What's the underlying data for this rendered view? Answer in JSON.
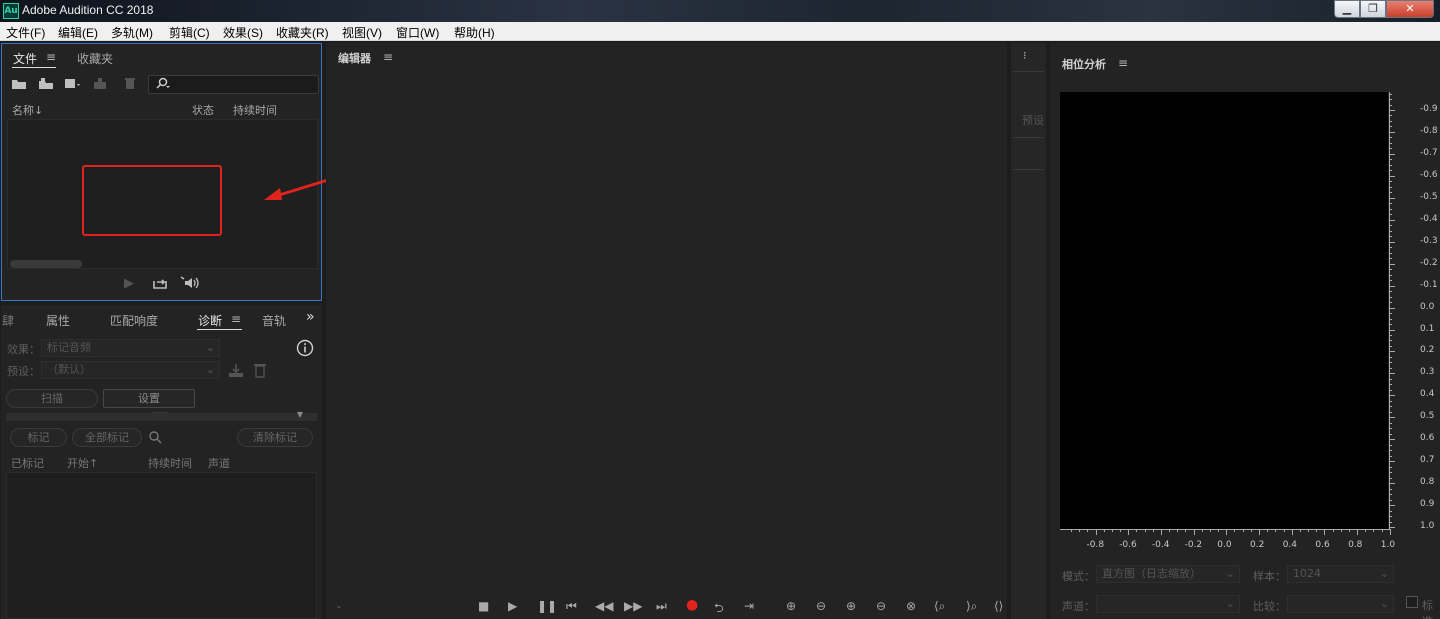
{
  "app": {
    "icon_text": "Au",
    "title": "Adobe Audition CC 2018"
  },
  "window_controls": {
    "minimize": "▁",
    "maximize": "❐",
    "close": "✕"
  },
  "menu": [
    "文件(F)",
    "编辑(E)",
    "多轨(M)",
    "剪辑(C)",
    "效果(S)",
    "收藏夹(R)",
    "视图(V)",
    "窗口(W)",
    "帮助(H)"
  ],
  "files_panel": {
    "tabs": [
      "文件",
      "收藏夹"
    ],
    "active_tab": "文件",
    "search_placeholder": "",
    "columns": [
      "名称",
      "状态",
      "持续时间"
    ],
    "sort_indicator": "↓",
    "icons": [
      "open-folder-icon",
      "import-icon",
      "new-file-icon",
      "insert-icon",
      "delete-icon"
    ]
  },
  "diagnostics_panel": {
    "tabs": [
      "属性",
      "匹配响度",
      "诊断",
      "音轨"
    ],
    "active_tab": "诊断",
    "overflow": "»",
    "effect_label": "效果：",
    "effect_value": "标记音频",
    "preset_label": "预设：",
    "preset_value": "（默认）",
    "scan_button": "扫描",
    "settings_button": "设置",
    "mark_button": "标记",
    "mark_all_button": "全部标记",
    "clear_marks_button": "清除标记",
    "columns": [
      "已标记",
      "开始",
      "持续时间",
      "声道"
    ],
    "sort_indicator": "↑"
  },
  "editor_panel": {
    "title": "编辑器",
    "time_display": "-"
  },
  "side_strip": {
    "label": "预设"
  },
  "phase_panel": {
    "title": "相位分析",
    "mode_label": "模式：",
    "mode_value": "直方图（日志缩放）",
    "samples_label": "样本：",
    "samples_value": "1024",
    "channel_label": "声道：",
    "channel_value": "",
    "compare_label": "比较：",
    "compare_value": "",
    "checkbox_label": "标准",
    "y_ticks": [
      "-0.9",
      "-0.8",
      "-0.7",
      "-0.6",
      "-0.5",
      "-0.4",
      "-0.3",
      "-0.2",
      "-0.1",
      "0.0",
      "0.1",
      "0.2",
      "0.3",
      "0.4",
      "0.5",
      "0.6",
      "0.7",
      "0.8",
      "0.9",
      "1.0"
    ],
    "x_ticks": [
      "-0.8",
      "-0.6",
      "-0.4",
      "-0.2",
      "0.0",
      "0.2",
      "0.4",
      "0.6",
      "0.8",
      "1.0"
    ]
  },
  "colors": {
    "accent_blue": "#3d74c7",
    "highlight_red": "#e0231d",
    "record_red": "#e0231d",
    "panel_bg": "#232323"
  }
}
